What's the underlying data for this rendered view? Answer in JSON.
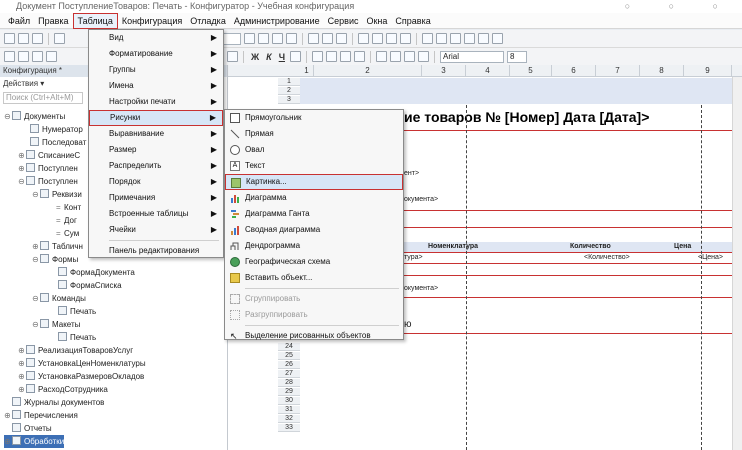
{
  "window": {
    "title": "Документ ПоступлениеТоваров: Печать - Конфигуратор - Учебная конфигурация",
    "controls": "○ ○ ○"
  },
  "menubar": [
    "Файл",
    "Правка",
    "Таблица",
    "Конфигурация",
    "Отладка",
    "Администрирование",
    "Сервис",
    "Окна",
    "Справка"
  ],
  "toolbar2": {
    "bold": "Ж",
    "italic": "К",
    "underline": "Ч",
    "font": "Arial",
    "size": "8"
  },
  "left_panel": {
    "header": "Конфигурация *",
    "actions": "Действия ▾",
    "search_placeholder": "Поиск (Ctrl+Alt+M)",
    "tree": [
      "Документы",
      "Нумератор",
      "Последоват",
      "СписаниеС",
      "Поступлен",
      "Поступлен",
      "Реквизи",
      "Конт",
      "Дог",
      "Сум",
      "Табличн",
      "Формы",
      "ФормаДокумента",
      "ФормаСписка",
      "Команды",
      "Печать",
      "Макеты",
      "Печать",
      "РеализацияТоваровУслуг",
      "УстановкаЦенНоменклатуры",
      "УстановкаРазмеровОкладов",
      "РасходСотрудника",
      "Журналы документов",
      "Перечисления",
      "Отчеты",
      "Обработки"
    ]
  },
  "sheet": {
    "columns": [
      "1",
      "2",
      "3",
      "4",
      "5",
      "6",
      "7",
      "8",
      "9"
    ],
    "rows_top": [
      "1",
      "2",
      "3"
    ],
    "rows_bottom": [
      "24",
      "25",
      "26",
      "27",
      "28",
      "29",
      "30",
      "31",
      "32",
      "33"
    ],
    "title": "ие товаров № [Номер] Дата [Дата]>",
    "texts": {
      "t1": "ент>",
      "t2": "окумента>",
      "h_nom": "Номенклатура",
      "h_qty": "Количество",
      "h_price": "Цена",
      "v_nom": "тура>",
      "v_qty": "<Количество>",
      "v_price": "<Цена>",
      "t3": "окумента>",
      "t4": "ю"
    }
  },
  "menu_table": {
    "items": [
      "Вид",
      "Форматирование",
      "Группы",
      "Имена",
      "Настройки печати",
      "Рисунки",
      "Выравнивание",
      "Размер",
      "Распределить",
      "Порядок",
      "Примечания",
      "Встроенные таблицы",
      "Ячейки",
      "Панель редактирования"
    ]
  },
  "menu_pictures": {
    "items": [
      "Прямоугольник",
      "Прямая",
      "Овал",
      "Текст",
      "Картинка...",
      "Диаграмма",
      "Диаграмма Ганта",
      "Сводная диаграмма",
      "Дендрограмма",
      "Географическая схема",
      "Вставить объект...",
      "Сгруппировать",
      "Разгруппировать",
      "Выделение рисованных объектов"
    ]
  },
  "colors": {
    "highlight_border": "#c83232",
    "highlight_bg": "#d7e6f7",
    "red_line": "#c83232"
  }
}
